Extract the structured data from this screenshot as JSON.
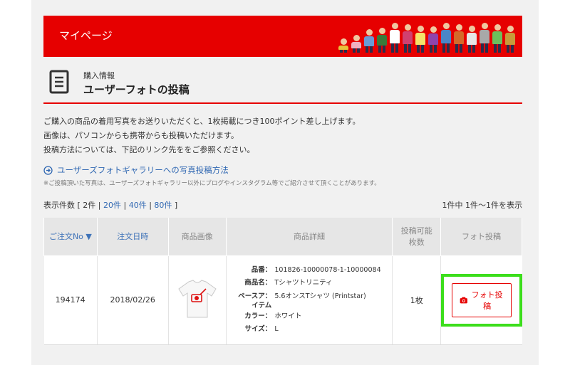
{
  "banner": {
    "title": "マイページ"
  },
  "section": {
    "category": "購入情報",
    "title": "ユーザーフォトの投稿"
  },
  "intro": {
    "lines": [
      "ご購入の商品の着用写真をお送りいただくと、1枚掲載につき100ポイント差し上げます。",
      "画像は、パソコンからも携帯からも投稿いただけます。",
      "投稿方法については、下記のリンク先ををご参照ください。"
    ]
  },
  "howto": {
    "link": "ユーザーズフォトギャラリーへの写真投稿方法"
  },
  "note": "※ご投稿頂いた写真は、ユーザーズフォトギャラリー以外にブログやインスタグラム等でご紹介させて頂くことがあります。",
  "pager": {
    "label": "表示件数 [",
    "options": [
      "2件",
      "20件",
      "40件",
      "80件"
    ],
    "close": "]",
    "summary": "1件中 1件～1件を表示"
  },
  "table": {
    "headers": {
      "order_no": "ご注文No ▼",
      "order_date": "注文日時",
      "image": "商品画像",
      "details": "商品詳細",
      "count_1": "投稿可能",
      "count_2": "枚数",
      "photo": "フォト投稿"
    },
    "row": {
      "order_no": "194174",
      "order_date": "2018/02/26",
      "details": {
        "sku_label": "品番：",
        "sku": "101826-10000078-1-10000084",
        "name_label": "商品名：",
        "name": "Tシャツトリニティ",
        "base_label": "ベースア",
        "base_label2": "イテム",
        "base_sep": "：",
        "base": "5.6オンスTシャツ (Printstar)",
        "color_label": "カラー：",
        "color": "ホワイト",
        "size_label": "サイズ：",
        "size": "L"
      },
      "count": "1枚",
      "photo_button": "フォト投稿"
    }
  },
  "colors": {
    "brand_red": "#e60000",
    "link_blue": "#2f67b2",
    "highlight_green": "#3cde1c"
  }
}
